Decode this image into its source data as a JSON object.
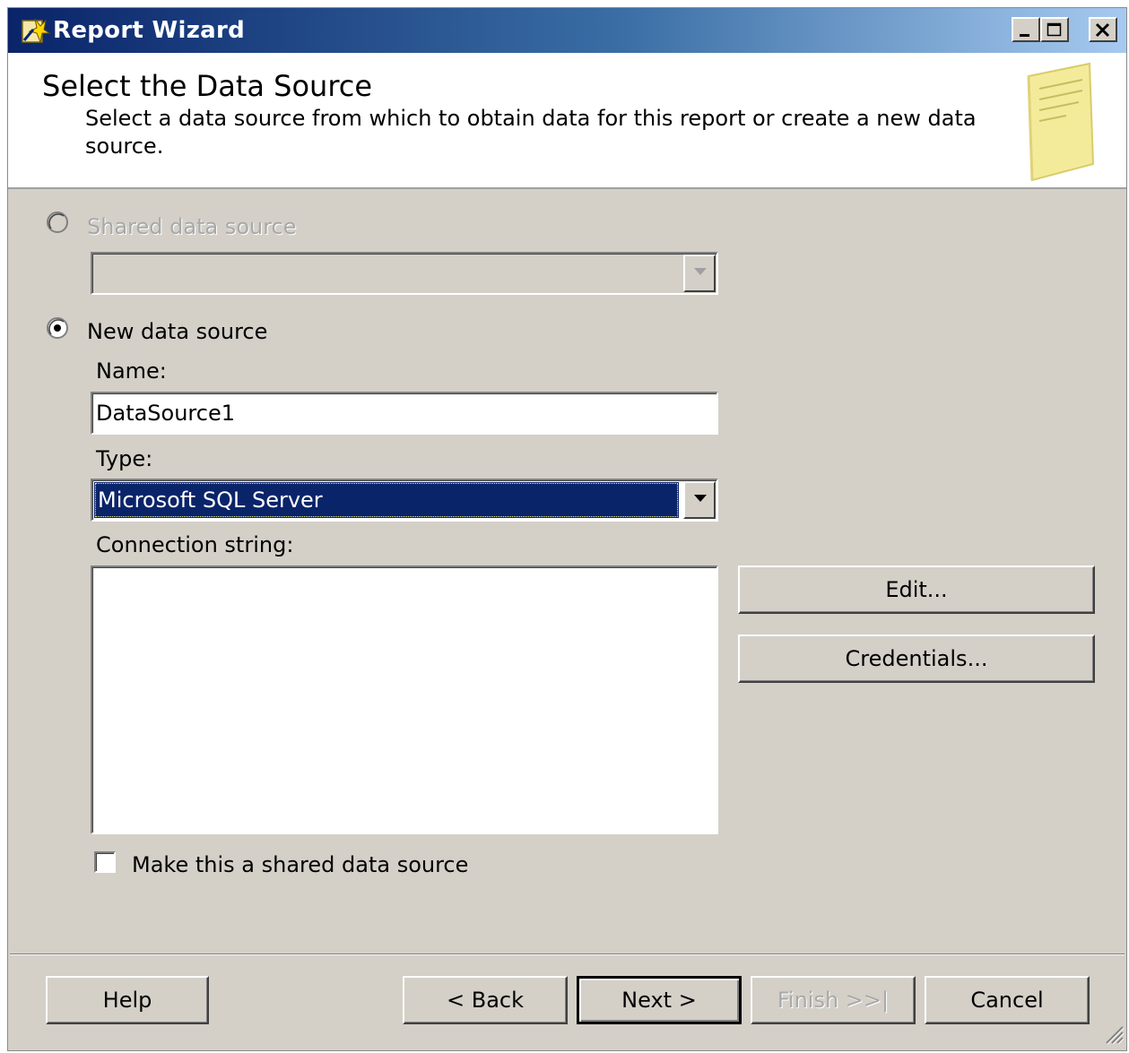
{
  "window": {
    "title": "Report Wizard"
  },
  "header": {
    "title": "Select the Data Source",
    "description": "Select a data source from which to obtain data for this report or create a new data source."
  },
  "form": {
    "shared_source_label": "Shared data source",
    "shared_source_value": "",
    "new_source_label": "New data source",
    "selected_option": "New data source",
    "name_label": "Name:",
    "name_value": "DataSource1",
    "type_label": "Type:",
    "type_value": "Microsoft SQL Server",
    "connection_label": "Connection string:",
    "connection_value": "",
    "edit_button": "Edit...",
    "credentials_button": "Credentials...",
    "make_shared_label": "Make this a shared data source",
    "make_shared_checked": false
  },
  "footer": {
    "help": "Help",
    "back": "< Back",
    "next": "Next >",
    "finish": "Finish >>|",
    "cancel": "Cancel"
  },
  "colors": {
    "title_bar_start": "#0a246a",
    "title_bar_end": "#a6caf0",
    "dialog_face": "#d4d0c8",
    "selection": "#0a246a"
  }
}
